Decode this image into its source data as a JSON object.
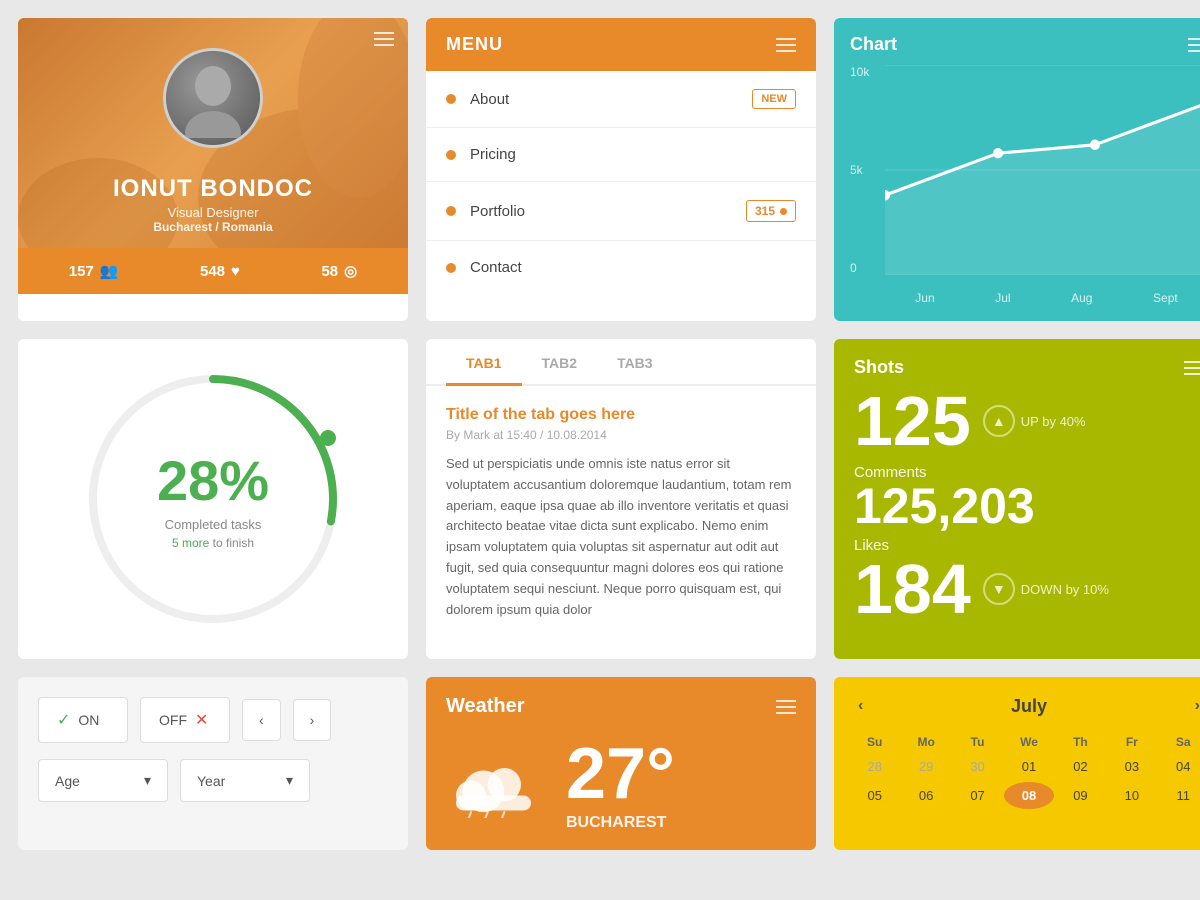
{
  "profile": {
    "name": "IONUT BONDOC",
    "title": "Visual Designer",
    "location": "Bucharest / Romania",
    "stats": [
      {
        "value": "157",
        "icon": "👥"
      },
      {
        "value": "548",
        "icon": "♥"
      },
      {
        "value": "58",
        "icon": "◎"
      }
    ]
  },
  "menu": {
    "title": "MENU",
    "items": [
      {
        "label": "About",
        "badge": "NEW",
        "badge_type": "new"
      },
      {
        "label": "Pricing",
        "badge": "",
        "badge_type": "none"
      },
      {
        "label": "Portfolio",
        "badge": "315",
        "badge_type": "num"
      },
      {
        "label": "Contact",
        "badge": "",
        "badge_type": "none"
      }
    ]
  },
  "chart": {
    "title": "Chart",
    "labels_y": [
      "10k",
      "5k",
      "0"
    ],
    "labels_x": [
      "Jun",
      "Jul",
      "Aug",
      "Sept"
    ],
    "points": [
      {
        "x": 0,
        "y": 0.62
      },
      {
        "x": 0.35,
        "y": 0.42
      },
      {
        "x": 0.65,
        "y": 0.38
      },
      {
        "x": 1.0,
        "y": 0.18
      }
    ]
  },
  "progress": {
    "percent": "28%",
    "label": "Completed tasks",
    "more_text": "5 more",
    "finish_text": " to finish",
    "value": 28
  },
  "tabs": {
    "items": [
      "TAB1",
      "TAB2",
      "TAB3"
    ],
    "active": 0,
    "content": {
      "title": "Title of the tab goes here",
      "meta": "By Mark at 15:40 / 10.08.2014",
      "body": "Sed ut perspiciatis unde omnis iste natus error sit voluptatem accusantium doloremque laudantium, totam rem aperiam, eaque ipsa quae ab illo inventore veritatis et quasi architecto beatae vitae dicta sunt explicabo. Nemo enim ipsam voluptatem quia voluptas sit aspernatur aut odit aut fugit, sed quia consequuntur magni dolores eos qui ratione voluptatem sequi nesciunt. Neque porro quisquam est, qui dolorem ipsum quia dolor"
    }
  },
  "shots_stats": {
    "title": "Shots",
    "shots_value": "125",
    "shots_trend": "UP by 40%",
    "comments_label": "Comments",
    "comments_value": "125,203",
    "likes_label": "Likes",
    "likes_value": "184",
    "likes_trend": "DOWN by 10%"
  },
  "controls": {
    "on_label": "ON",
    "off_label": "OFF"
  },
  "dropdowns": {
    "age_label": "Age",
    "year_label": "Year"
  },
  "weather": {
    "title": "Weather",
    "temp": "27°",
    "city": "BUCHAREST"
  },
  "calendar": {
    "month": "July",
    "nav_prev": "‹",
    "nav_next": "›",
    "day_names": [
      "Su",
      "Mo",
      "Tu",
      "We",
      "Th",
      "Fr",
      "Sa"
    ],
    "days": [
      {
        "day": "28",
        "class": "prev-month"
      },
      {
        "day": "29",
        "class": "prev-month"
      },
      {
        "day": "30",
        "class": "prev-month"
      },
      {
        "day": "01",
        "class": ""
      },
      {
        "day": "02",
        "class": ""
      },
      {
        "day": "03",
        "class": ""
      },
      {
        "day": "04",
        "class": ""
      },
      {
        "day": "05",
        "class": ""
      },
      {
        "day": "06",
        "class": ""
      },
      {
        "day": "07",
        "class": ""
      },
      {
        "day": "08",
        "class": "today"
      },
      {
        "day": "09",
        "class": ""
      },
      {
        "day": "10",
        "class": ""
      },
      {
        "day": "11",
        "class": ""
      }
    ]
  }
}
